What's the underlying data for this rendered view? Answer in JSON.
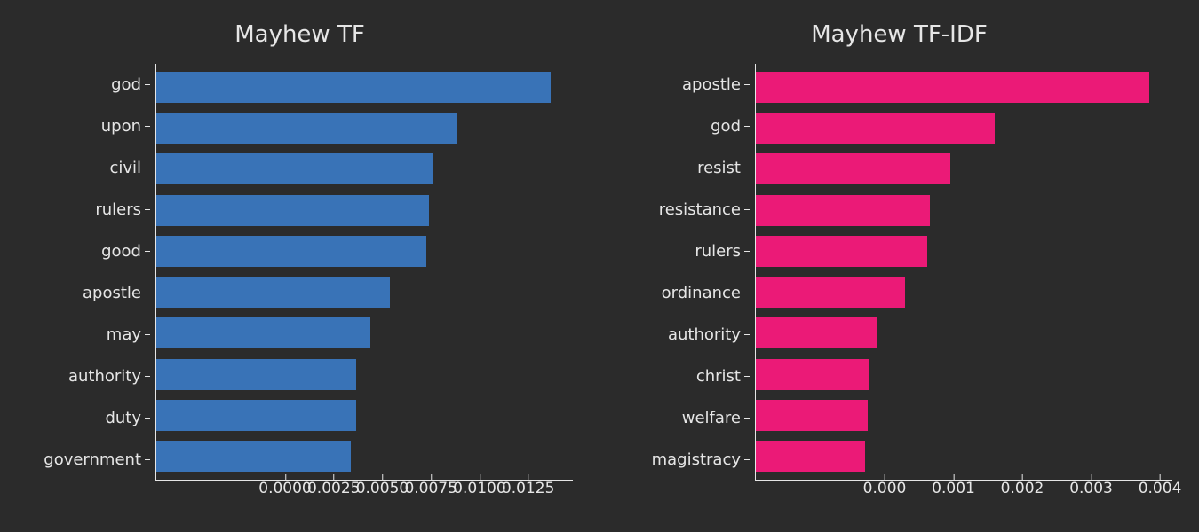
{
  "chart_data": [
    {
      "type": "bar",
      "orientation": "horizontal",
      "title": "Mayhew TF",
      "color": "#3973b7",
      "categories": [
        "god",
        "upon",
        "civil",
        "rulers",
        "good",
        "apostle",
        "may",
        "authority",
        "duty",
        "government"
      ],
      "values": [
        0.014,
        0.0107,
        0.0098,
        0.0097,
        0.0096,
        0.0083,
        0.0076,
        0.0071,
        0.0071,
        0.0069
      ],
      "xlabel": "",
      "ylabel": "",
      "xlim": [
        0.0,
        0.0148
      ],
      "xticks": [
        0.0,
        0.0025,
        0.005,
        0.0075,
        0.01,
        0.0125
      ],
      "xtick_labels": [
        "0.0000",
        "0.0025",
        "0.0050",
        "0.0075",
        "0.0100",
        "0.0125"
      ]
    },
    {
      "type": "bar",
      "orientation": "horizontal",
      "title": "Mayhew TF-IDF",
      "color": "#eb1a77",
      "categories": [
        "apostle",
        "god",
        "resist",
        "resistance",
        "rulers",
        "ordinance",
        "authority",
        "christ",
        "welfare",
        "magistracy"
      ],
      "values": [
        0.00395,
        0.0024,
        0.00195,
        0.00175,
        0.00172,
        0.0015,
        0.00121,
        0.00113,
        0.00112,
        0.0011
      ],
      "xlabel": "",
      "ylabel": "",
      "xlim": [
        0.0,
        0.00418
      ],
      "xticks": [
        0.0,
        0.001,
        0.002,
        0.003,
        0.004
      ],
      "xtick_labels": [
        "0.000",
        "0.001",
        "0.002",
        "0.003",
        "0.004"
      ]
    }
  ]
}
